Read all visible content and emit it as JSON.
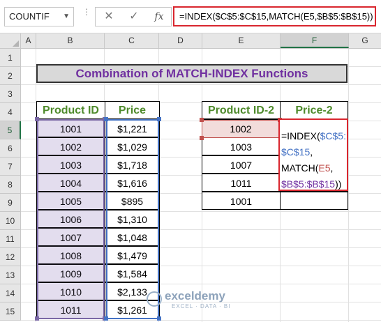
{
  "formula_bar": {
    "name_box": "COUNTIF",
    "cancel_glyph": "✕",
    "confirm_glyph": "✓",
    "fx_label": "fx",
    "formula": "=INDEX($C$5:$C$15,MATCH(E5,$B$5:$B$15))"
  },
  "columns": [
    "A",
    "B",
    "C",
    "D",
    "E",
    "F",
    "G"
  ],
  "selected_column": "F",
  "rows": [
    "1",
    "2",
    "3",
    "4",
    "5",
    "6",
    "7",
    "8",
    "9",
    "10",
    "11",
    "12",
    "13",
    "14",
    "15"
  ],
  "selected_row": "5",
  "title": "Combination of MATCH-INDEX Functions",
  "left_table": {
    "headers": [
      "Product ID",
      "Price"
    ],
    "rows": [
      [
        "1001",
        "$1,221"
      ],
      [
        "1002",
        "$1,029"
      ],
      [
        "1003",
        "$1,718"
      ],
      [
        "1004",
        "$1,616"
      ],
      [
        "1005",
        "$895"
      ],
      [
        "1006",
        "$1,310"
      ],
      [
        "1007",
        "$1,048"
      ],
      [
        "1008",
        "$1,479"
      ],
      [
        "1009",
        "$1,584"
      ],
      [
        "1010",
        "$2,133"
      ],
      [
        "1011",
        "$1,261"
      ]
    ]
  },
  "right_table": {
    "headers": [
      "Product ID-2",
      "Price-2"
    ],
    "ids": [
      "1002",
      "1003",
      "1007",
      "1011",
      "1001"
    ]
  },
  "cell_edit": {
    "line1_prefix": "=INDEX(",
    "line1_ref": "$C$5:",
    "line2_ref": "$C$15",
    "line2_suffix": ",",
    "line3_prefix": "MATCH(",
    "line3_ref": "E5",
    "line3_suffix": ",",
    "line4_ref": "$B$5:$B$15",
    "line4_suffix": "))"
  },
  "watermark": {
    "name": "exceldemy",
    "tagline": "EXCEL · DATA · BI"
  },
  "colors": {
    "header_green": "#4e8a2b",
    "title_purple": "#7030a0",
    "edit_border_red": "#d9262e",
    "range_blue": "#4472c4",
    "range_purple": "#7b68a6"
  }
}
